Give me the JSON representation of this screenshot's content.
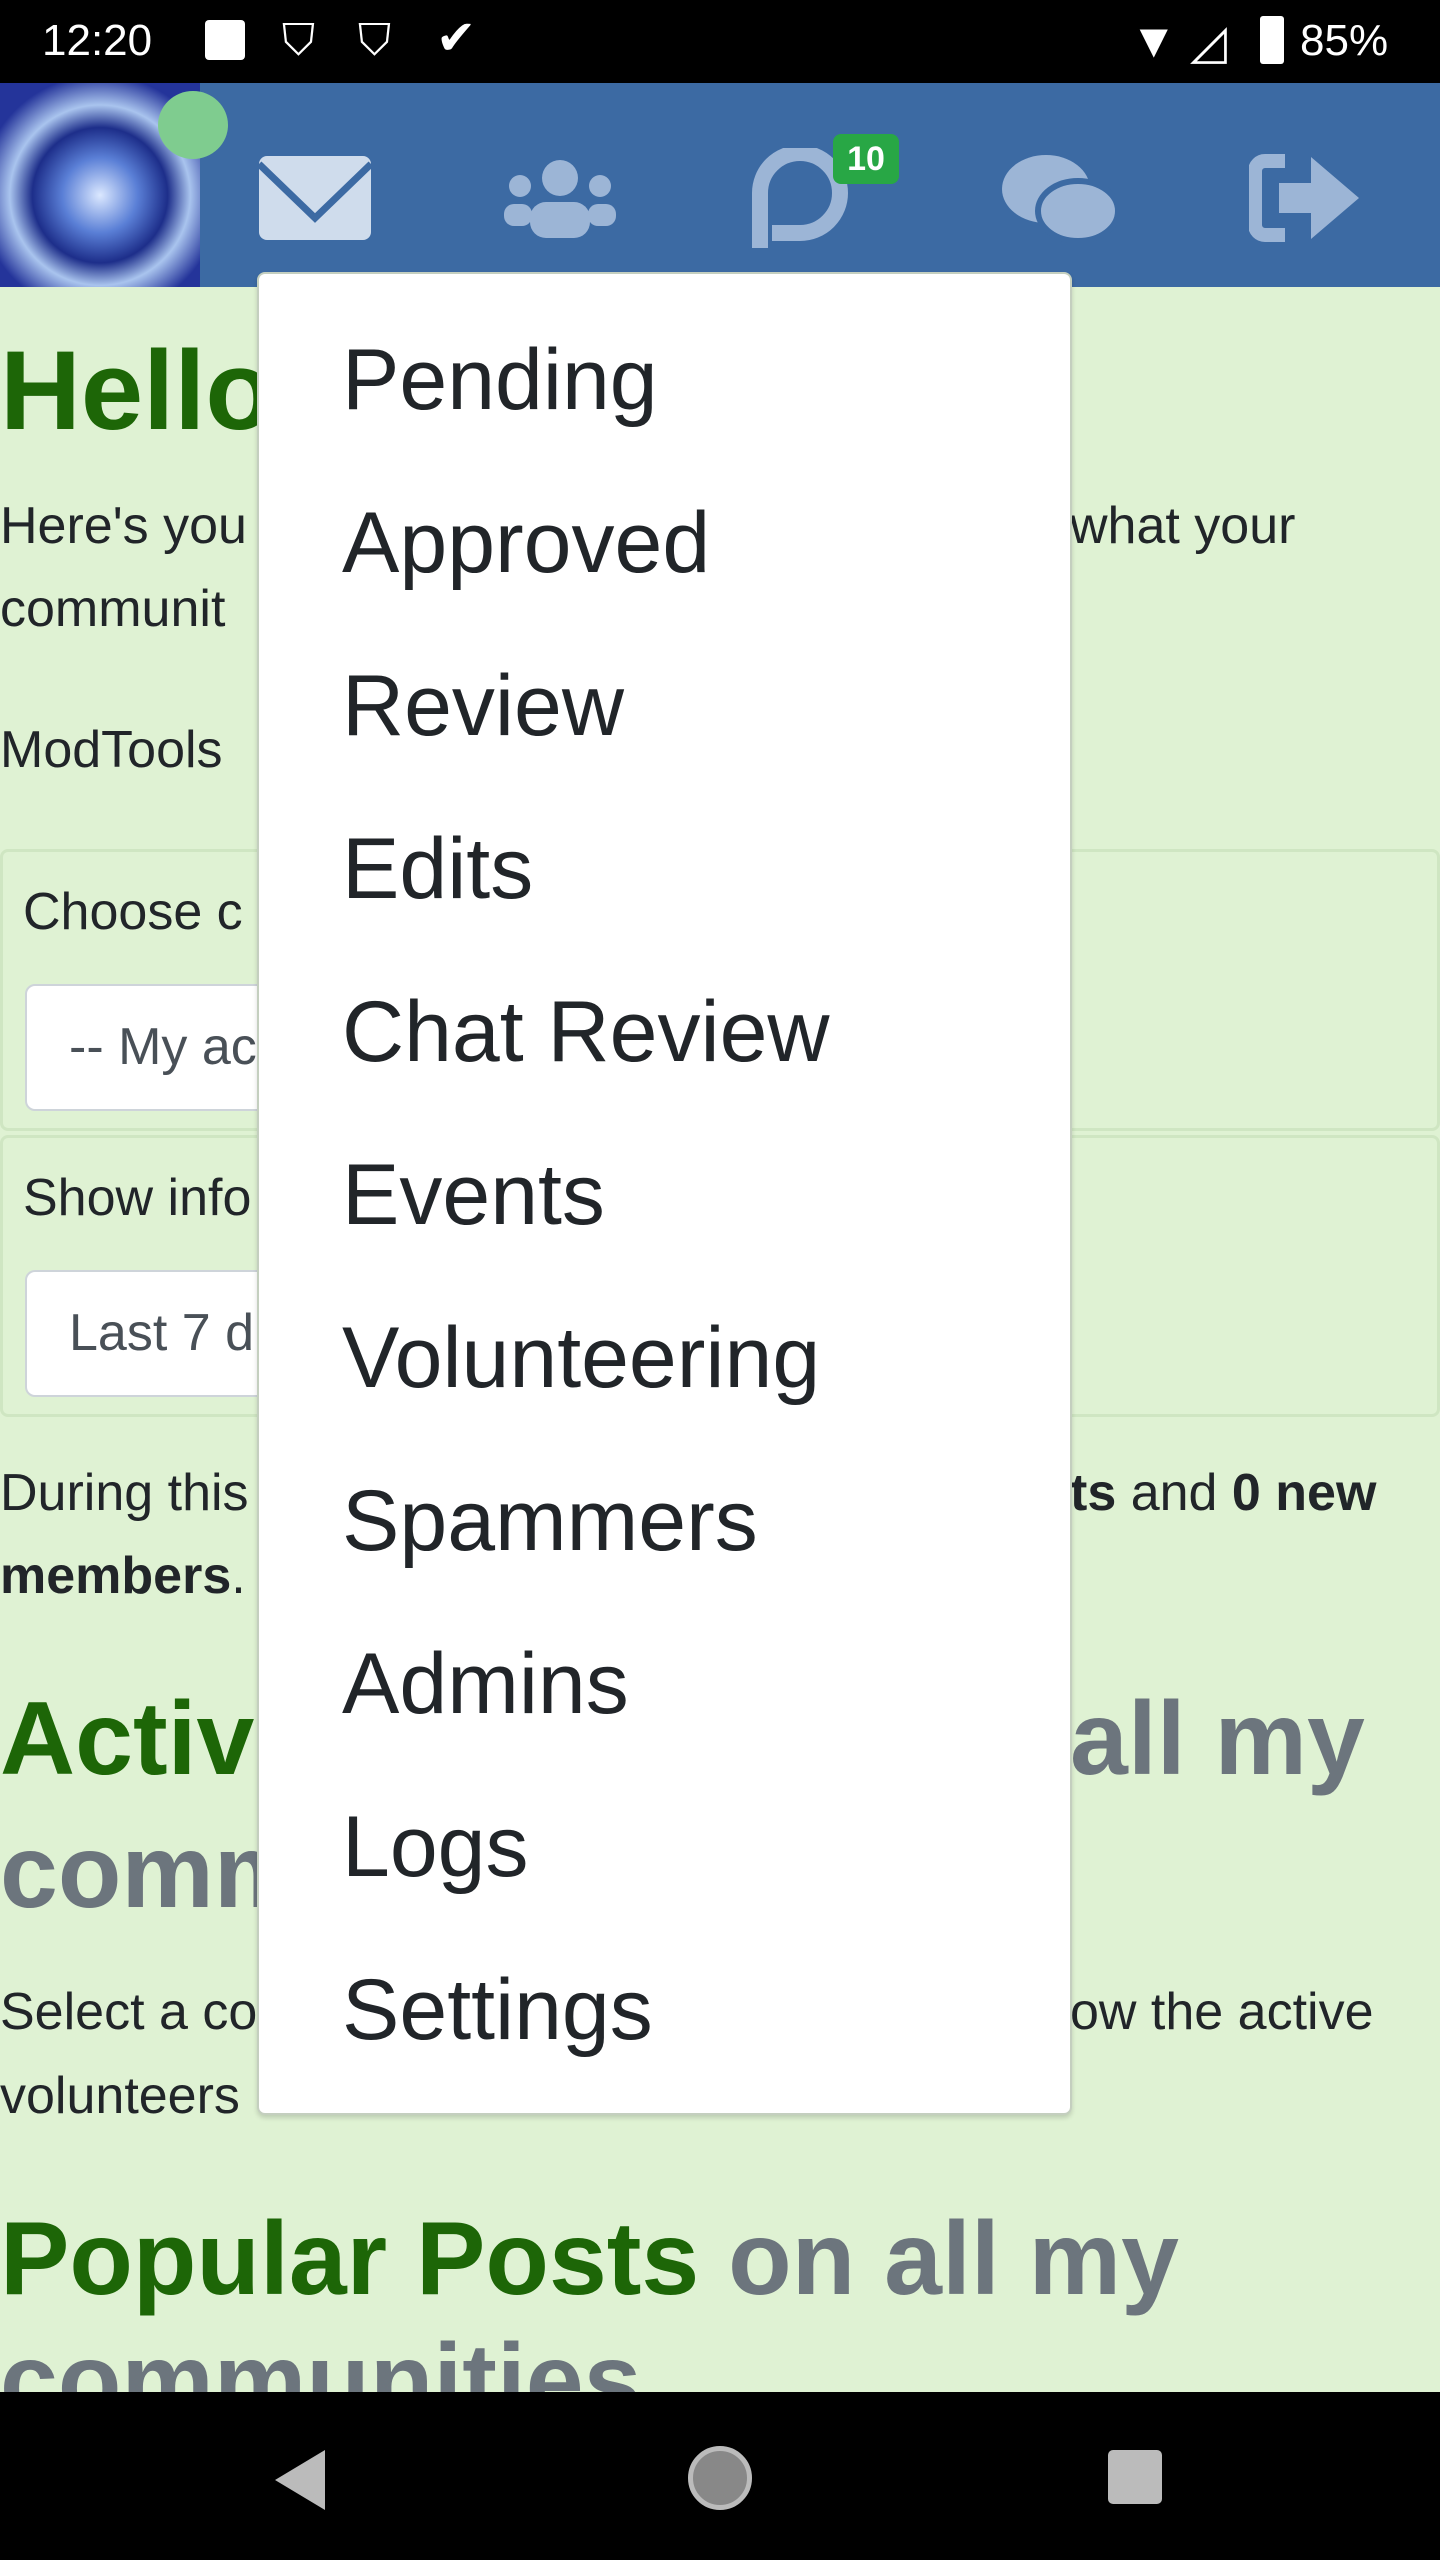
{
  "status_bar": {
    "time": "12:20",
    "battery": "85%",
    "icons": [
      "image-icon",
      "shield-alert-icon",
      "shield-alert-icon",
      "download-done-icon",
      "wifi-icon",
      "signal-off-icon",
      "battery-icon"
    ]
  },
  "header": {
    "colors": {
      "bar": "#3c6aa3",
      "icon": "#9cb5d6",
      "badge": "#28a745",
      "online": "#7fcc8f"
    },
    "chat_badge": "10",
    "icons": [
      "avatar",
      "envelope-icon",
      "users-icon",
      "discourse-chat-icon",
      "comments-icon",
      "sign-out-icon"
    ]
  },
  "main": {
    "greeting": "Hello",
    "intro_left_1": "Here's you",
    "intro_right_1": "what your",
    "intro_left_2": "communit",
    "modtools": "ModTools",
    "choose_label": "Choose c",
    "choose_value": "-- My ac",
    "show_label": "Show info",
    "show_value": "Last 7 d",
    "during_left": "During this",
    "during_right_bold": "ts",
    "during_and": " and ",
    "during_new": "0 new",
    "members": "members",
    "active_left": "Activ",
    "active_right": "all my",
    "active_line2": "comm",
    "select_left": "Select a co",
    "select_right": "ow the active",
    "volunteers": "volunteers",
    "popular_green": "Popular Posts",
    "popular_grey": " on all my",
    "popular_line2": "communities"
  },
  "menu": {
    "items": [
      "Pending",
      "Approved",
      "Review",
      "Edits",
      "Chat Review",
      "Events",
      "Volunteering",
      "Spammers",
      "Admins",
      "Logs",
      "Settings"
    ]
  }
}
